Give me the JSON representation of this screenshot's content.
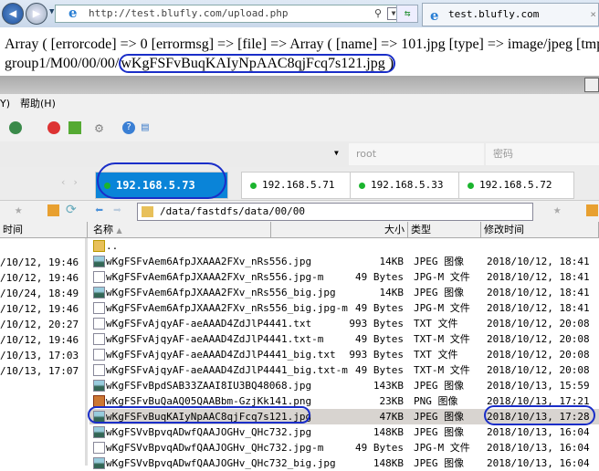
{
  "browser": {
    "url": "http://test.blufly.com/upload.php",
    "tab_title": "test.blufly.com",
    "tab_close": "×"
  },
  "page": {
    "line1": "Array ( [errorcode] => 0 [errormsg] => [file] => Array ( [name] => 101.jpg [type] => image/jpeg [tmp",
    "line2_prefix": "group1/M00/00/00/",
    "line2_file": "wKgFSFvBuqKAIyNpAAC8qjFcq7s121.jpg )"
  },
  "menu": {
    "partial": "Y)",
    "help": "帮助(H)"
  },
  "login": {
    "user": "root",
    "password_placeholder": "密码"
  },
  "server_tabs": [
    {
      "label": "192.168.5.73",
      "active": true
    },
    {
      "label": "192.168.5.71"
    },
    {
      "label": "192.168.5.33"
    },
    {
      "label": "192.168.5.72"
    }
  ],
  "path": "/data/fastdfs/data/00/00",
  "columns": {
    "left_time": "时间",
    "name": "名称",
    "size": "大小",
    "type": "类型",
    "modified": "修改时间"
  },
  "left_times": [
    "/10/12, 19:46",
    "/10/12, 19:46",
    "/10/24, 18:49",
    "/10/12, 19:46",
    "/10/12, 20:27",
    "/10/12, 19:46",
    "/10/13, 17:03",
    "/10/13, 17:07"
  ],
  "files": [
    {
      "name": "..",
      "size": "",
      "type": "",
      "date": "",
      "icon": "folder"
    },
    {
      "name": "wKgFSFvAem6AfpJXAAA2FXv_nRs556.jpg",
      "size": "14KB",
      "type": "JPEG 图像",
      "date": "2018/10/12, 18:41",
      "icon": "img"
    },
    {
      "name": "wKgFSFvAem6AfpJXAAA2FXv_nRs556.jpg-m",
      "size": "49 Bytes",
      "type": "JPG-M 文件",
      "date": "2018/10/12, 18:41",
      "icon": "file"
    },
    {
      "name": "wKgFSFvAem6AfpJXAAA2FXv_nRs556_big.jpg",
      "size": "14KB",
      "type": "JPEG 图像",
      "date": "2018/10/12, 18:41",
      "icon": "img"
    },
    {
      "name": "wKgFSFvAem6AfpJXAAA2FXv_nRs556_big.jpg-m",
      "size": "49 Bytes",
      "type": "JPG-M 文件",
      "date": "2018/10/12, 18:41",
      "icon": "file"
    },
    {
      "name": "wKgFSFvAjqyAF-aeAAAD4ZdJlP4441.txt",
      "size": "993 Bytes",
      "type": "TXT 文件",
      "date": "2018/10/12, 20:08",
      "icon": "file"
    },
    {
      "name": "wKgFSFvAjqyAF-aeAAAD4ZdJlP4441.txt-m",
      "size": "49 Bytes",
      "type": "TXT-M 文件",
      "date": "2018/10/12, 20:08",
      "icon": "file"
    },
    {
      "name": "wKgFSFvAjqyAF-aeAAAD4ZdJlP4441_big.txt",
      "size": "993 Bytes",
      "type": "TXT 文件",
      "date": "2018/10/12, 20:08",
      "icon": "file"
    },
    {
      "name": "wKgFSFvAjqyAF-aeAAAD4ZdJlP4441_big.txt-m",
      "size": "49 Bytes",
      "type": "TXT-M 文件",
      "date": "2018/10/12, 20:08",
      "icon": "file"
    },
    {
      "name": "wKgFSFvBpdSAB33ZAAI8IU3BQ48068.jpg",
      "size": "143KB",
      "type": "JPEG 图像",
      "date": "2018/10/13, 15:59",
      "icon": "img"
    },
    {
      "name": "wKgFSFvBuQaAQ05QAABbm-GzjKk141.png",
      "size": "23KB",
      "type": "PNG 图像",
      "date": "2018/10/13, 17:21",
      "icon": "png"
    },
    {
      "name": "wKgFSFvBuqKAIyNpAAC8qjFcq7s121.jpg",
      "size": "47KB",
      "type": "JPEG 图像",
      "date": "2018/10/13, 17:28",
      "icon": "img",
      "selected": true
    },
    {
      "name": "wKgFSVvBpvqADwfQAAJOGHv_QHc732.jpg",
      "size": "148KB",
      "type": "JPEG 图像",
      "date": "2018/10/13, 16:04",
      "icon": "img"
    },
    {
      "name": "wKgFSVvBpvqADwfQAAJOGHv_QHc732.jpg-m",
      "size": "49 Bytes",
      "type": "JPG-M 文件",
      "date": "2018/10/13, 16:04",
      "icon": "file"
    },
    {
      "name": "wKgFSVvBpvqADwfQAAJOGHv_QHc732_big.jpg",
      "size": "148KB",
      "type": "JPEG 图像",
      "date": "2018/10/13, 16:04",
      "icon": "img"
    }
  ]
}
